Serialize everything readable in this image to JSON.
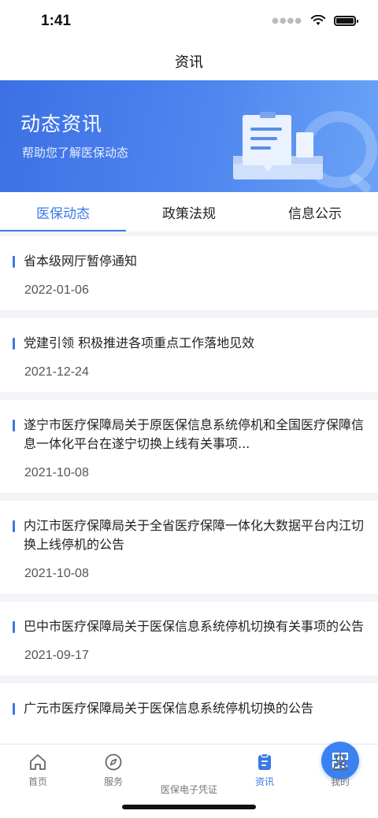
{
  "status": {
    "time": "1:41"
  },
  "nav": {
    "title": "资讯"
  },
  "banner": {
    "title": "动态资讯",
    "subtitle": "帮助您了解医保动态"
  },
  "tabs": [
    {
      "label": "医保动态",
      "active": true
    },
    {
      "label": "政策法规",
      "active": false
    },
    {
      "label": "信息公示",
      "active": false
    }
  ],
  "news": [
    {
      "title": "省本级网厅暂停通知",
      "date": "2022-01-06"
    },
    {
      "title": "党建引领 积极推进各项重点工作落地见效",
      "date": "2021-12-24"
    },
    {
      "title": "遂宁市医疗保障局关于原医保信息系统停机和全国医疗保障信息一体化平台在遂宁切换上线有关事项...",
      "date": "2021-10-08"
    },
    {
      "title": "内江市医疗保障局关于全省医疗保障一体化大数据平台内江切换上线停机的公告",
      "date": "2021-10-08"
    },
    {
      "title": "巴中市医疗保障局关于医保信息系统停机切换有关事项的公告",
      "date": "2021-09-17"
    },
    {
      "title": "广元市医疗保障局关于医保信息系统停机切换的公告",
      "date": ""
    }
  ],
  "tabbar": {
    "home": "首页",
    "service": "服务",
    "ecard": "医保电子凭证",
    "news": "资讯",
    "mine": "我的"
  },
  "colors": {
    "accent": "#3b78e7",
    "banner_start": "#3c70e4",
    "banner_end": "#6aa3f7"
  },
  "icons": {
    "home": "home-icon",
    "service": "compass-icon",
    "ecard": "qr-code-icon",
    "news": "document-icon",
    "mine": "user-icon"
  }
}
